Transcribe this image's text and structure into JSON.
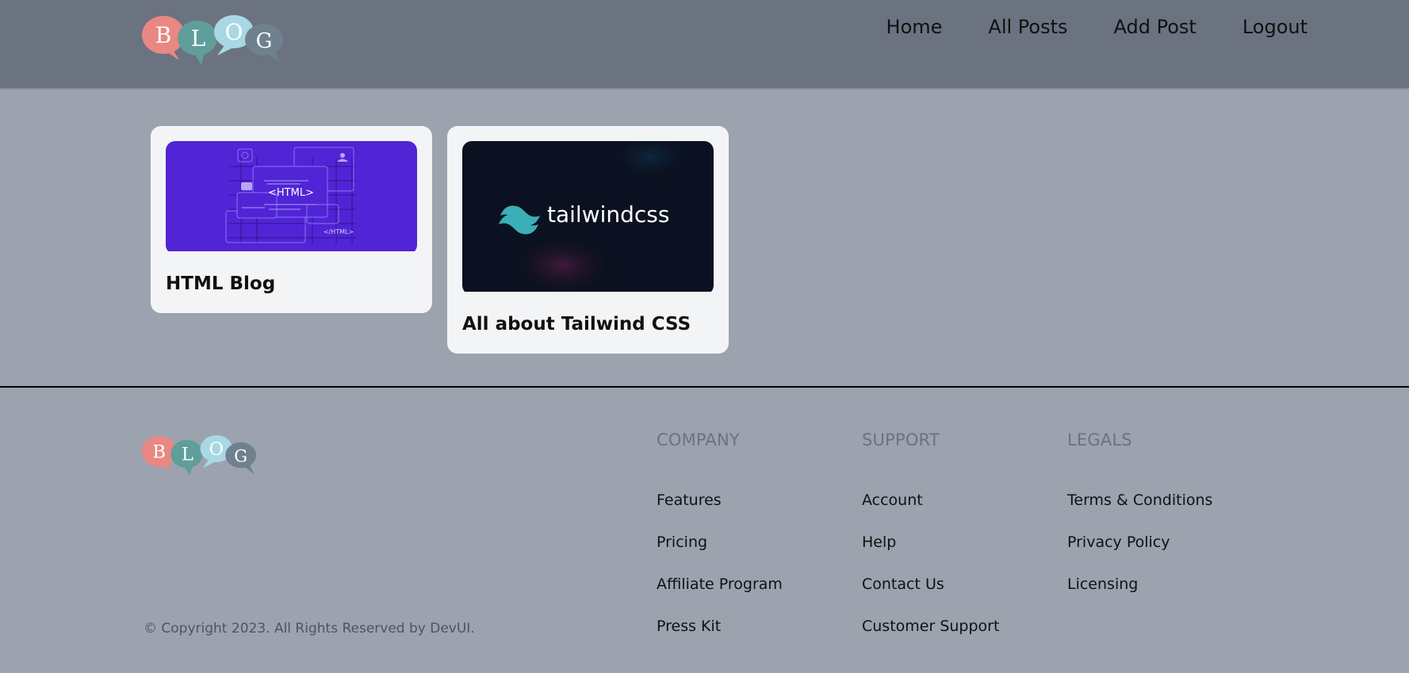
{
  "header": {
    "logo_letters": [
      "B",
      "L",
      "O",
      "G"
    ],
    "nav": [
      {
        "label": "Home"
      },
      {
        "label": "All Posts"
      },
      {
        "label": "Add Post"
      },
      {
        "label": "Logout"
      }
    ]
  },
  "posts": [
    {
      "title": "HTML Blog",
      "image_text": "<HTML>",
      "image_caption": "</HTML>",
      "image_bg": "#5124d6"
    },
    {
      "title": "All about Tailwind CSS",
      "image_text": "tailwindcss",
      "image_bg": "#0b1120"
    }
  ],
  "footer": {
    "columns": [
      {
        "heading": "COMPANY",
        "links": [
          "Features",
          "Pricing",
          "Affiliate Program",
          "Press Kit"
        ]
      },
      {
        "heading": "SUPPORT",
        "links": [
          "Account",
          "Help",
          "Contact Us",
          "Customer Support"
        ]
      },
      {
        "heading": "LEGALS",
        "links": [
          "Terms & Conditions",
          "Privacy Policy",
          "Licensing"
        ]
      }
    ],
    "copyright": "© Copyright 2023. All Rights Reserved by DevUI."
  },
  "colors": {
    "header_bg": "#6b7280",
    "page_bg": "#9ca3af",
    "card_bg": "#f3f4f6",
    "bubble_b": "#e98783",
    "bubble_l": "#5f9e9b",
    "bubble_o": "#a9d8e4",
    "bubble_g": "#6f808e",
    "tailwind_teal": "#38bdf8"
  }
}
